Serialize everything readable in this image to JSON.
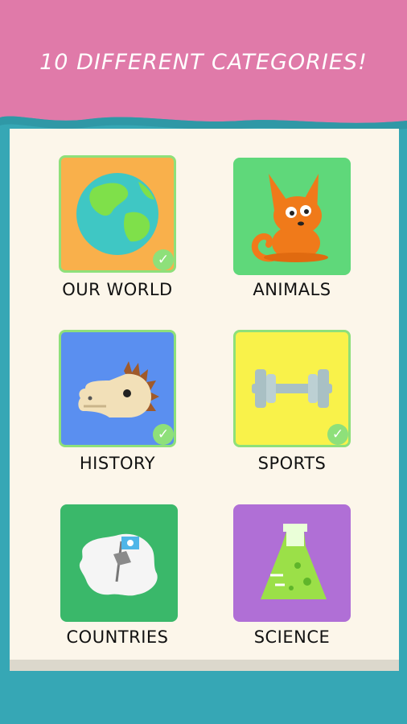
{
  "header": {
    "title": "10 DIFFERENT CATEGORIES!"
  },
  "colors": {
    "banner": "#e07aa9",
    "background": "#36a7b5",
    "panel": "#fcf6ea"
  },
  "categories": [
    {
      "label": "OUR WORLD",
      "icon": "globe-icon",
      "completed": true,
      "color": "#f9b04b"
    },
    {
      "label": "ANIMALS",
      "icon": "fox-icon",
      "completed": false,
      "color": "#5fd87a"
    },
    {
      "label": "HISTORY",
      "icon": "dinosaur-skull-icon",
      "completed": true,
      "color": "#5a8ff0"
    },
    {
      "label": "SPORTS",
      "icon": "dumbbell-icon",
      "completed": true,
      "color": "#f9f24a"
    },
    {
      "label": "COUNTRIES",
      "icon": "antarctica-flag-icon",
      "completed": false,
      "color": "#3ab86a"
    },
    {
      "label": "SCIENCE",
      "icon": "flask-icon",
      "completed": false,
      "color": "#b06fd6"
    }
  ]
}
